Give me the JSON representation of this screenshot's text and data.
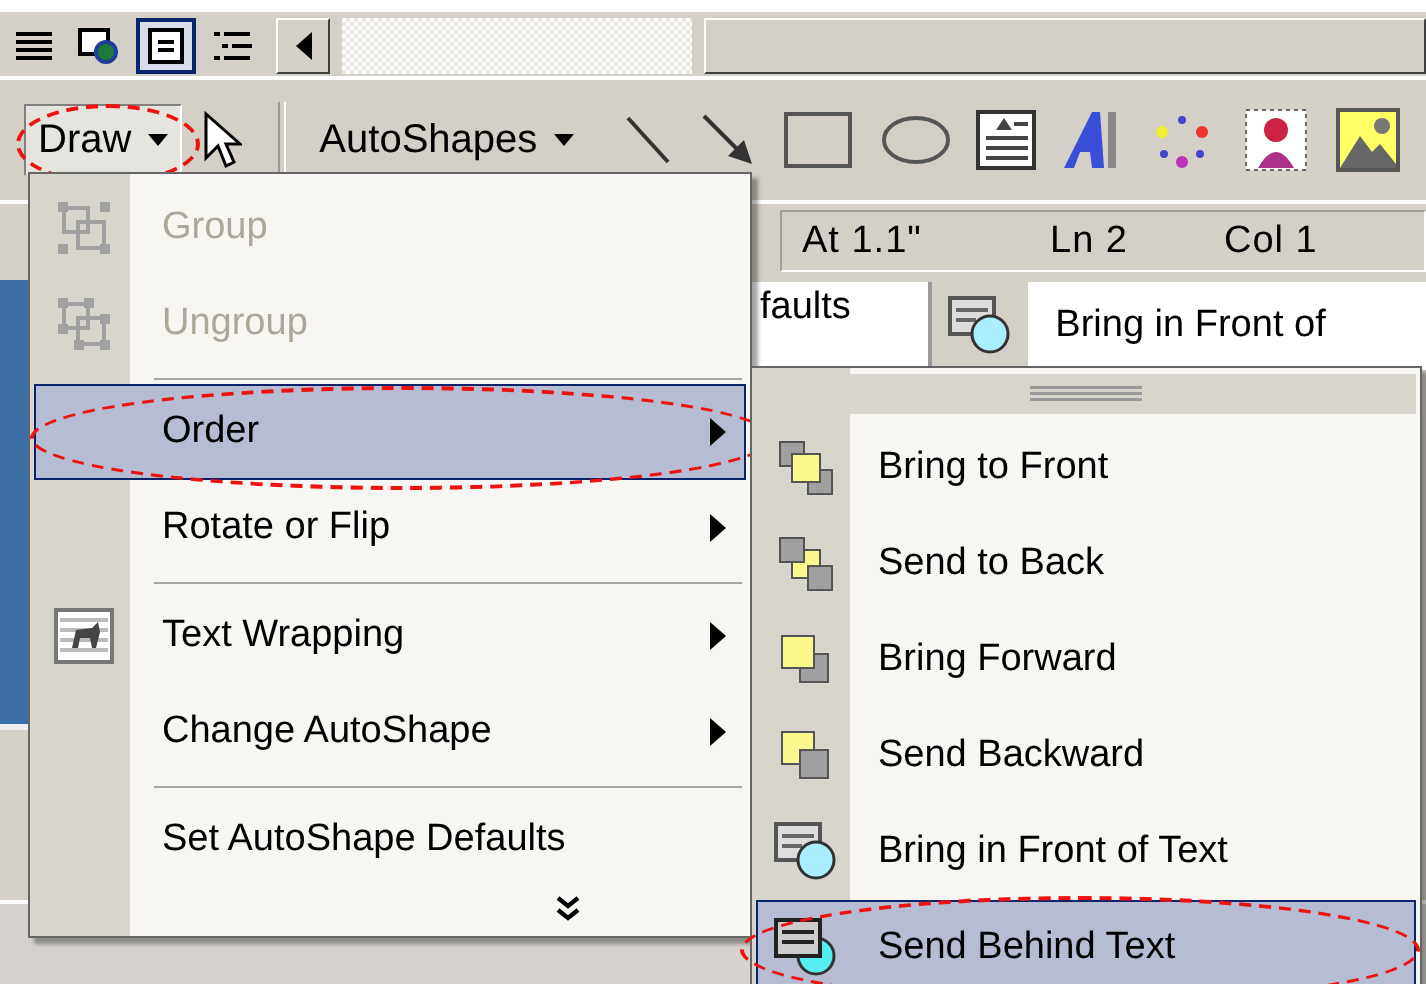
{
  "view_bar": {
    "buttons": [
      {
        "kind": "normal",
        "selected": false
      },
      {
        "kind": "web",
        "selected": false
      },
      {
        "kind": "print",
        "selected": true
      },
      {
        "kind": "outline",
        "selected": false
      }
    ]
  },
  "drawing_toolbar": {
    "draw_button": {
      "label": "Draw",
      "open": true,
      "circled": true
    },
    "autoshapes_button": {
      "label": "AutoShapes"
    },
    "tools": [
      {
        "kind": "select"
      },
      {
        "kind": "separator"
      },
      {
        "kind": "autoshapes"
      },
      {
        "kind": "line"
      },
      {
        "kind": "arrow"
      },
      {
        "kind": "rectangle"
      },
      {
        "kind": "oval"
      },
      {
        "kind": "textbox"
      },
      {
        "kind": "wordart"
      },
      {
        "kind": "diagram"
      },
      {
        "kind": "clipart"
      },
      {
        "kind": "picture"
      }
    ]
  },
  "status_bar": {
    "position": "At 1.1\"",
    "line": "Ln 2",
    "column": "Col 1"
  },
  "order_toolbar": {
    "partial_text": "faults",
    "button_label": "Bring in Front of"
  },
  "draw_menu": {
    "items": [
      {
        "kind": "command",
        "label": "Group",
        "disabled": true,
        "selected": false,
        "submenu": false,
        "circled": false
      },
      {
        "kind": "command",
        "label": "Ungroup",
        "disabled": true,
        "selected": false,
        "submenu": false,
        "circled": false
      },
      {
        "kind": "separator"
      },
      {
        "kind": "command",
        "label": "Order",
        "disabled": false,
        "selected": true,
        "submenu": true,
        "circled": true
      },
      {
        "kind": "command",
        "label": "Rotate or Flip",
        "disabled": false,
        "selected": false,
        "submenu": true,
        "circled": false
      },
      {
        "kind": "separator"
      },
      {
        "kind": "command",
        "label": "Text Wrapping",
        "disabled": false,
        "selected": false,
        "submenu": true,
        "circled": false
      },
      {
        "kind": "command",
        "label": "Change AutoShape",
        "disabled": false,
        "selected": false,
        "submenu": true,
        "circled": false
      },
      {
        "kind": "separator"
      },
      {
        "kind": "command",
        "label": "Set AutoShape Defaults",
        "disabled": false,
        "selected": false,
        "submenu": false,
        "circled": false
      },
      {
        "kind": "expand"
      }
    ]
  },
  "order_submenu": {
    "items": [
      {
        "kind": "grip"
      },
      {
        "kind": "command",
        "label": "Bring to Front",
        "disabled": false,
        "selected": false,
        "submenu": false,
        "circled": false
      },
      {
        "kind": "command",
        "label": "Send to Back",
        "disabled": false,
        "selected": false,
        "submenu": false,
        "circled": false
      },
      {
        "kind": "command",
        "label": "Bring Forward",
        "disabled": false,
        "selected": false,
        "submenu": false,
        "circled": false
      },
      {
        "kind": "command",
        "label": "Send Backward",
        "disabled": false,
        "selected": false,
        "submenu": false,
        "circled": false
      },
      {
        "kind": "command",
        "label": "Bring in Front of Text",
        "disabled": false,
        "selected": false,
        "submenu": false,
        "circled": false
      },
      {
        "kind": "command",
        "label": "Send Behind Text",
        "disabled": false,
        "selected": true,
        "submenu": false,
        "circled": true
      }
    ]
  }
}
